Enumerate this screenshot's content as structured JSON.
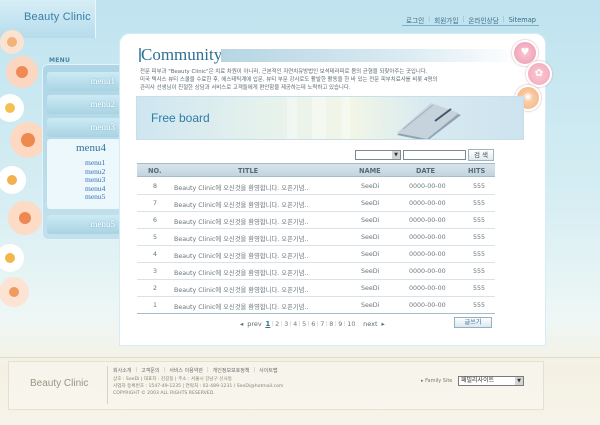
{
  "header": {
    "logo": "Beauty Clinic",
    "nav": [
      "로그인",
      "회원가입",
      "온라인상담",
      "Sitemap"
    ]
  },
  "sidebar": {
    "label": "MENU",
    "items": [
      {
        "label": "menu1"
      },
      {
        "label": "menu2"
      },
      {
        "label": "menu3"
      }
    ],
    "active": {
      "title": "menu4",
      "subitems": [
        "menu1",
        "menu2",
        "menu3",
        "menu4",
        "menu5"
      ]
    },
    "last_item": "menu5"
  },
  "main": {
    "title": "Community",
    "intro": [
      "전문 피부과 \"Beauty Clinic\"은 치료 차원이 아니라, 근본적인 자연치유방법인 보석테라피로 몸의 균형을 되찾아주는 곳입니다.",
      "미국 텍사스 뷰티 스쿨을 수료한 후, 에스테틱계에 입문, 뷰티 부문 강사로도 활발한 활동을 한 바 있는 전문 피부치료사를 비롯 4명의",
      "관리사 선생님이 친절한 상담과 서비스로 고객들에게 편안함을 제공하는데 노력하고 있습니다."
    ],
    "banner_title": "Free board"
  },
  "search": {
    "button": "검 색"
  },
  "table": {
    "headers": {
      "no": "NO.",
      "title": "TITLE",
      "name": "NAME",
      "date": "DATE",
      "hits": "HITS"
    },
    "rows": [
      {
        "no": "8",
        "title": "Beauty Clinic에 오신것을 환영합니다. 오픈기념..",
        "name": "SeeDi",
        "date": "0000-00-00",
        "hits": "555"
      },
      {
        "no": "7",
        "title": "Beauty Clinic에 오신것을 환영합니다. 오픈기념..",
        "name": "SeeDi",
        "date": "0000-00-00",
        "hits": "555"
      },
      {
        "no": "6",
        "title": "Beauty Clinic에 오신것을 환영합니다. 오픈기념..",
        "name": "SeeDi",
        "date": "0000-00-00",
        "hits": "555"
      },
      {
        "no": "5",
        "title": "Beauty Clinic에 오신것을 환영합니다. 오픈기념..",
        "name": "SeeDi",
        "date": "0000-00-00",
        "hits": "555"
      },
      {
        "no": "4",
        "title": "Beauty Clinic에 오신것을 환영합니다. 오픈기념..",
        "name": "SeeDi",
        "date": "0000-00-00",
        "hits": "555"
      },
      {
        "no": "3",
        "title": "Beauty Clinic에 오신것을 환영합니다. 오픈기념..",
        "name": "SeeDi",
        "date": "0000-00-00",
        "hits": "555"
      },
      {
        "no": "2",
        "title": "Beauty Clinic에 오신것을 환영합니다. 오픈기념..",
        "name": "SeeDi",
        "date": "0000-00-00",
        "hits": "555"
      },
      {
        "no": "1",
        "title": "Beauty Clinic에 오신것을 환영합니다. 오픈기념..",
        "name": "SeeDi",
        "date": "0000-00-00",
        "hits": "555"
      }
    ]
  },
  "pagination": {
    "prev": "prev",
    "next": "next",
    "pages": [
      "1",
      "2",
      "3",
      "4",
      "5",
      "6",
      "7",
      "8",
      "9",
      "10"
    ],
    "current": "1"
  },
  "write_button": "글쓰기",
  "footer": {
    "logo": "Beauty Clinic",
    "links": [
      "회사소개",
      "고객문의",
      "서비스 이용약관",
      "개인정보보호정책",
      "사이트맵"
    ],
    "info": [
      "상호 : SeeDi  |  대표자 : 김길동  |  주소 : 서울시 강남구 신사동",
      "사업자 등록번호 : 1547-49-1235  |  연락처 : 02-489-1231 / SeeDi@hotmail.com",
      "COPYRIGHT © 2003  ALL RIGHTS RESERVED."
    ],
    "family_label": "▸ Family Site",
    "family_select": "패밀리사이트"
  },
  "colors": {
    "accent": "#2f6f92",
    "sidebar": "#aed6e7",
    "circle1": "#f2a9bd",
    "circle2": "#f6b3c4",
    "circle3": "#f7c49a"
  }
}
